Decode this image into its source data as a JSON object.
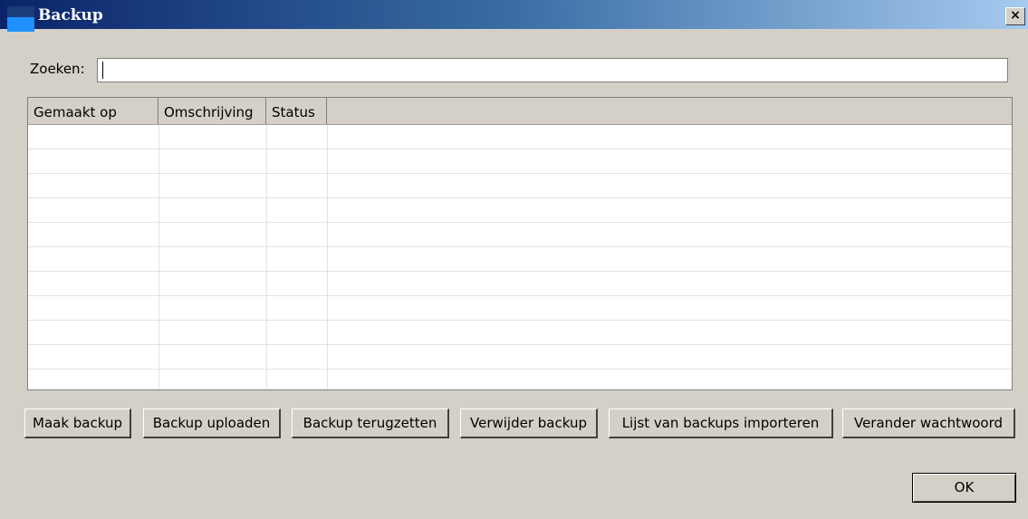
{
  "window": {
    "title": "Backup",
    "close_glyph": "×",
    "icon": "app-icon"
  },
  "search": {
    "label": "Zoeken:",
    "value": ""
  },
  "table": {
    "columns": [
      "Gemaakt op",
      "Omschrijving",
      "Status",
      ""
    ],
    "rows": []
  },
  "buttons": {
    "make_backup": "Maak backup",
    "upload_backup": "Backup uploaden",
    "restore_backup": "Backup terugzetten",
    "delete_backup": "Verwijder backup",
    "import_list": "Lijst van backups importeren",
    "change_password": "Verander wachtwoord",
    "ok": "OK"
  }
}
